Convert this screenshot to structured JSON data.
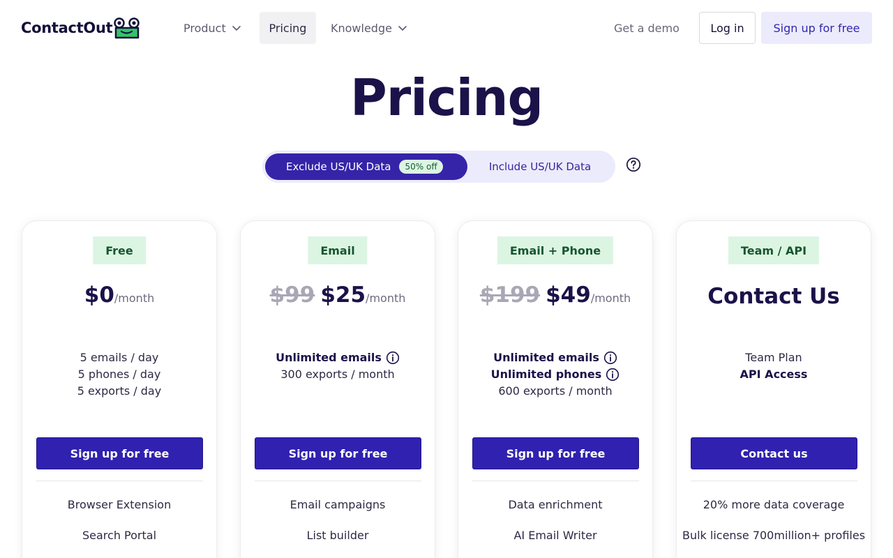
{
  "brand": {
    "name": "ContactOut"
  },
  "nav": {
    "product": "Product",
    "pricing": "Pricing",
    "knowledge": "Knowledge",
    "demo": "Get a demo",
    "login": "Log in",
    "signup": "Sign up for free"
  },
  "page": {
    "title": "Pricing"
  },
  "toggle": {
    "exclude_label": "Exclude US/UK Data",
    "discount_badge": "50% off",
    "include_label": "Include US/UK Data"
  },
  "plans": [
    {
      "badge": "Free",
      "price": "$0",
      "per": "/month",
      "features": [
        "5 emails / day",
        "5 phones / day",
        "5 exports / day"
      ],
      "cta": "Sign up for free",
      "extras": [
        "Browser Extension",
        "Search Portal"
      ]
    },
    {
      "badge": "Email",
      "old_price": "$99",
      "price": "$25",
      "per": "/month",
      "features": [
        "Unlimited emails",
        "300 exports / month"
      ],
      "cta": "Sign up for free",
      "extras": [
        "Email campaigns",
        "List builder"
      ]
    },
    {
      "badge": "Email + Phone",
      "old_price": "$199",
      "price": "$49",
      "per": "/month",
      "features": [
        "Unlimited emails",
        "Unlimited phones",
        "600 exports / month"
      ],
      "cta": "Sign up for free",
      "extras": [
        "Data enrichment",
        "AI Email Writer"
      ]
    },
    {
      "badge": "Team / API",
      "heading": "Contact Us",
      "features": [
        "Team Plan",
        "API Access"
      ],
      "cta": "Contact us",
      "extras": [
        "20% more data coverage",
        "Bulk license 700million+ profiles"
      ]
    }
  ],
  "colors": {
    "primary": "#3021b0",
    "navy": "#1b1249",
    "badge_green_bg": "#dcf5e3",
    "badge_green_text": "#17562e",
    "toggle_bg": "#ecebfb"
  }
}
